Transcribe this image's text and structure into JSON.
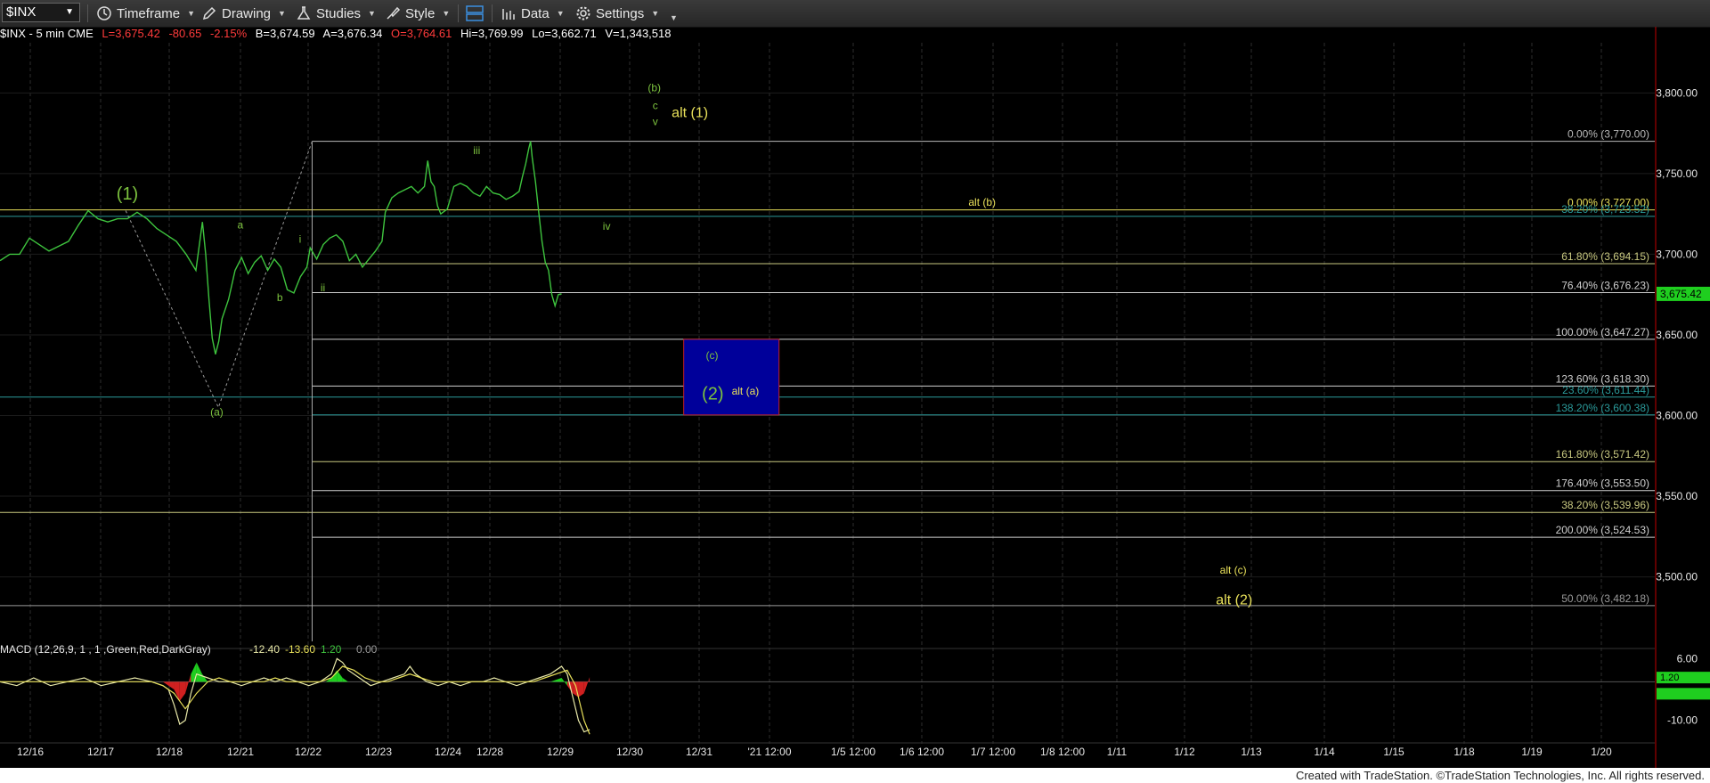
{
  "toolbar": {
    "symbol": "$INX",
    "items": [
      {
        "label": "Timeframe",
        "icon": "clock-icon"
      },
      {
        "label": "Drawing",
        "icon": "pencil-icon"
      },
      {
        "label": "Studies",
        "icon": "flask-icon"
      },
      {
        "label": "Style",
        "icon": "style-icon"
      },
      {
        "label": "Data",
        "icon": "data-icon"
      },
      {
        "label": "Settings",
        "icon": "gear-icon"
      }
    ],
    "layout_icon": "layout-icon"
  },
  "info_bar": {
    "symbol": "$INX - 5 min  CME",
    "last": "L=3,675.42",
    "change": "-80.65",
    "change_pct": "-2.15%",
    "bid": "B=3,674.59",
    "ask": "A=3,676.34",
    "open": "O=3,764.61",
    "high": "Hi=3,769.99",
    "low": "Lo=3,662.71",
    "volume": "V=1,343,518"
  },
  "colors": {
    "price": "#3ec43e",
    "wave_green": "#7cc23e",
    "alt_yellow": "#e8e05a",
    "fib_white": "#cfcfcf",
    "fib_teal": "#2a9a9a",
    "target_box": "#00009a",
    "target_border": "#c0202a",
    "negative": "#ff3b3b",
    "current_price_bg": "#1fce1f"
  },
  "chart_data": [
    {
      "type": "line",
      "title": "$INX - 5 min",
      "x_ticks": [
        "12/16",
        "12/17",
        "12/18",
        "12/21",
        "12/22",
        "12/23",
        "12/24",
        "12/28",
        "12/29",
        "12/30",
        "12/31",
        "'21 12:00",
        "1/5 12:00",
        "1/6 12:00",
        "1/7 12:00",
        "1/8 12:00",
        "1/11",
        "1/12",
        "1/13",
        "1/14",
        "1/15",
        "1/18",
        "1/19",
        "1/20"
      ],
      "y_ticks": [
        "3,800.00",
        "3,750.00",
        "3,700.00",
        "3,650.00",
        "3,600.00",
        "3,550.00",
        "3,500.00"
      ],
      "ylim": [
        3460,
        3830
      ],
      "current_price": "3,675.42",
      "series": [
        {
          "points": [
            [
              0,
              3696
            ],
            [
              3,
              3700
            ],
            [
              6,
              3700
            ],
            [
              9,
              3710
            ],
            [
              12,
              3706
            ],
            [
              15,
              3702
            ],
            [
              18,
              3705
            ],
            [
              21,
              3708
            ],
            [
              24,
              3718
            ],
            [
              27,
              3727
            ],
            [
              30,
              3722
            ],
            [
              33,
              3720
            ],
            [
              36,
              3722
            ],
            [
              39,
              3722
            ],
            [
              42,
              3726
            ],
            [
              45,
              3722
            ],
            [
              48,
              3716
            ],
            [
              51,
              3712
            ],
            [
              54,
              3708
            ],
            [
              57,
              3700
            ],
            [
              60,
              3690
            ],
            [
              61,
              3705
            ],
            [
              62,
              3720
            ],
            [
              63,
              3700
            ],
            [
              64,
              3672
            ],
            [
              65,
              3648
            ],
            [
              66,
              3638
            ],
            [
              67,
              3646
            ],
            [
              68,
              3660
            ],
            [
              70,
              3672
            ],
            [
              72,
              3690
            ],
            [
              74,
              3698
            ],
            [
              76,
              3688
            ],
            [
              78,
              3695
            ],
            [
              80,
              3699
            ],
            [
              82,
              3690
            ],
            [
              84,
              3697
            ],
            [
              86,
              3692
            ],
            [
              88,
              3678
            ],
            [
              90,
              3676
            ],
            [
              92,
              3686
            ],
            [
              94,
              3692
            ],
            [
              95,
              3704
            ],
            [
              97,
              3697
            ],
            [
              99,
              3706
            ],
            [
              101,
              3710
            ],
            [
              103,
              3712
            ],
            [
              105,
              3708
            ],
            [
              107,
              3696
            ],
            [
              109,
              3700
            ],
            [
              111,
              3692
            ],
            [
              113,
              3697
            ],
            [
              115,
              3702
            ],
            [
              117,
              3708
            ],
            [
              118,
              3726
            ],
            [
              120,
              3735
            ],
            [
              122,
              3738
            ],
            [
              124,
              3740
            ],
            [
              126,
              3742
            ],
            [
              128,
              3738
            ],
            [
              130,
              3742
            ],
            [
              131,
              3758
            ],
            [
              132,
              3745
            ],
            [
              133,
              3742
            ],
            [
              134,
              3730
            ],
            [
              135,
              3725
            ],
            [
              137,
              3728
            ],
            [
              139,
              3742
            ],
            [
              141,
              3744
            ],
            [
              143,
              3742
            ],
            [
              145,
              3738
            ],
            [
              147,
              3736
            ],
            [
              149,
              3742
            ],
            [
              151,
              3738
            ],
            [
              153,
              3737
            ],
            [
              155,
              3734
            ],
            [
              157,
              3736
            ],
            [
              159,
              3739
            ],
            [
              160,
              3748
            ],
            [
              161,
              3756
            ],
            [
              162,
              3766
            ],
            [
              162.5,
              3770
            ],
            [
              163,
              3760
            ],
            [
              164,
              3745
            ],
            [
              165,
              3726
            ],
            [
              166,
              3708
            ],
            [
              167,
              3695
            ],
            [
              168,
              3690
            ],
            [
              169,
              3675
            ],
            [
              170,
              3668
            ],
            [
              171,
              3675
            ],
            [
              172,
              3675.4
            ]
          ]
        }
      ],
      "fib_levels": [
        {
          "label": "0.00% (3,770.00)",
          "value": 3770,
          "color": "#b8b8b8",
          "start": 95.6
        },
        {
          "label": "0.00% (3,727.00)",
          "value": 3727.5,
          "color": "#e8e05a",
          "start": 0
        },
        {
          "label": "38.20% (3,723.52)",
          "value": 3723.5,
          "color": "#2a9a9a",
          "start": 0
        },
        {
          "label": "61.80% (3,694.15)",
          "value": 3694.15,
          "color": "#c8c880",
          "start": 95.6
        },
        {
          "label": "76.40% (3,676.23)",
          "value": 3676.23,
          "color": "#cfcfcf",
          "start": 95.6
        },
        {
          "label": "100.00% (3,647.27)",
          "value": 3647.27,
          "color": "#cfcfcf",
          "start": 95.6
        },
        {
          "label": "123.60% (3,618.30)",
          "value": 3618.3,
          "color": "#cfcfcf",
          "start": 95.6
        },
        {
          "label": "23.60% (3,611.44)",
          "value": 3611.44,
          "color": "#2a9a9a",
          "start": 0
        },
        {
          "label": "138.20% (3,600.38)",
          "value": 3600.38,
          "color": "#2a9a9a",
          "start": 95.6
        },
        {
          "label": "161.80% (3,571.42)",
          "value": 3571.42,
          "color": "#c8c880",
          "start": 95.6
        },
        {
          "label": "176.40% (3,553.50)",
          "value": 3553.5,
          "color": "#cfcfcf",
          "start": 95.6
        },
        {
          "label": "38.20% (3,539.96)",
          "value": 3539.96,
          "color": "#c8c880",
          "start": 0
        },
        {
          "label": "200.00% (3,524.53)",
          "value": 3524.53,
          "color": "#cfcfcf",
          "start": 95.6
        },
        {
          "label": "50.00% (3,482.18)",
          "value": 3482.18,
          "color": "#9a9a9a",
          "start": 0
        }
      ],
      "target_box": {
        "x_start": 209.4,
        "x_end": 238.6,
        "y_top": 3647.27,
        "y_bottom": 3600.38
      },
      "annotations": [
        {
          "text": "(1)",
          "x": 39.0,
          "y": 3734,
          "color": "#7cc23e",
          "size": "large"
        },
        {
          "text": "a",
          "x": 73.6,
          "y": 3716,
          "color": "#7cc23e",
          "size": "small"
        },
        {
          "text": "b",
          "x": 85.7,
          "y": 3671,
          "color": "#7cc23e",
          "size": "small"
        },
        {
          "text": "(a)",
          "x": 66.4,
          "y": 3600,
          "color": "#7cc23e",
          "size": "small"
        },
        {
          "text": "i",
          "x": 91.9,
          "y": 3707,
          "color": "#7cc23e",
          "size": "small"
        },
        {
          "text": "ii",
          "x": 98.9,
          "y": 3677,
          "color": "#7cc23e",
          "size": "small"
        },
        {
          "text": "iii",
          "x": 146.0,
          "y": 3762,
          "color": "#7cc23e",
          "size": "small"
        },
        {
          "text": "iv",
          "x": 185.8,
          "y": 3715,
          "color": "#7cc23e",
          "size": "small"
        },
        {
          "text": "(b)",
          "x": 200.4,
          "y": 3801,
          "color": "#7cc23e",
          "size": "small"
        },
        {
          "text": "c",
          "x": 200.7,
          "y": 3790,
          "color": "#7cc23e",
          "size": "small"
        },
        {
          "text": "v",
          "x": 200.7,
          "y": 3780,
          "color": "#7cc23e",
          "size": "small"
        },
        {
          "text": "alt (1)",
          "x": 211.3,
          "y": 3785,
          "color": "#e8e05a",
          "size": "medium"
        },
        {
          "text": "alt (b)",
          "x": 300.8,
          "y": 3730,
          "color": "#e8e05a",
          "size": "small"
        },
        {
          "text": "(c)",
          "x": 218.1,
          "y": 3635,
          "color": "#7cc23e",
          "size": "small"
        },
        {
          "text": "(2)",
          "x": 218.3,
          "y": 3610,
          "color": "#7cc23e",
          "size": "large"
        },
        {
          "text": "alt (a)",
          "x": 228.3,
          "y": 3613,
          "color": "#e8e05a",
          "size": "small"
        },
        {
          "text": "alt (c)",
          "x": 377.7,
          "y": 3502,
          "color": "#e8e05a",
          "size": "small"
        },
        {
          "text": "alt (2)",
          "x": 378.0,
          "y": 3483,
          "color": "#e8e05a",
          "size": "medium"
        }
      ],
      "dotted_lines": [
        [
          [
            38.5,
            3727
          ],
          [
            66.9,
            3605
          ],
          [
            95.6,
            3770
          ]
        ]
      ],
      "vertical_line": {
        "x": 95.6,
        "y_from": 3770,
        "y_to": 3460
      }
    },
    {
      "type": "line",
      "title": "MACD (12,26,9, 1 , 1 ,Green,Red,DarkGray)",
      "legend_values": [
        "-12.40",
        "-13.60",
        "1.20",
        "0.00"
      ],
      "legend_colors": [
        "#e8e8a8",
        "#e8e05a",
        "#3ec43e",
        "#9a9a9a"
      ],
      "y_ticks": [
        "6.00",
        "-10.00"
      ],
      "current_value": "1.20",
      "ylim": [
        -14,
        7
      ],
      "x_max": 210,
      "macd": [
        [
          0,
          0
        ],
        [
          6,
          -1
        ],
        [
          12,
          1
        ],
        [
          18,
          -1
        ],
        [
          24,
          0
        ],
        [
          30,
          1
        ],
        [
          36,
          -1
        ],
        [
          42,
          0
        ],
        [
          48,
          1
        ],
        [
          54,
          0
        ],
        [
          58,
          -1
        ],
        [
          60,
          -2
        ],
        [
          62,
          -6
        ],
        [
          64,
          -11
        ],
        [
          66,
          -10
        ],
        [
          68,
          -3
        ],
        [
          70,
          2
        ],
        [
          74,
          1
        ],
        [
          78,
          0
        ],
        [
          82,
          0
        ],
        [
          86,
          -1
        ],
        [
          90,
          0
        ],
        [
          94,
          1
        ],
        [
          98,
          0
        ],
        [
          102,
          1
        ],
        [
          106,
          0
        ],
        [
          110,
          -1
        ],
        [
          114,
          0
        ],
        [
          118,
          2
        ],
        [
          120,
          6
        ],
        [
          122,
          5
        ],
        [
          124,
          3
        ],
        [
          128,
          1
        ],
        [
          132,
          -1
        ],
        [
          136,
          0
        ],
        [
          140,
          1
        ],
        [
          144,
          2
        ],
        [
          146,
          4
        ],
        [
          148,
          2
        ],
        [
          152,
          0
        ],
        [
          156,
          -1
        ],
        [
          160,
          0
        ],
        [
          164,
          -1
        ],
        [
          168,
          0
        ],
        [
          172,
          0
        ],
        [
          176,
          1
        ],
        [
          180,
          0
        ],
        [
          184,
          -1
        ],
        [
          188,
          0
        ],
        [
          192,
          1
        ],
        [
          196,
          2
        ],
        [
          200,
          4
        ],
        [
          202,
          2
        ],
        [
          204,
          -4
        ],
        [
          206,
          -10
        ],
        [
          208,
          -13
        ],
        [
          210,
          -12.4
        ]
      ],
      "signal": [
        [
          0,
          0
        ],
        [
          6,
          0
        ],
        [
          12,
          0
        ],
        [
          18,
          0
        ],
        [
          24,
          0
        ],
        [
          30,
          0
        ],
        [
          36,
          0
        ],
        [
          42,
          0
        ],
        [
          48,
          0
        ],
        [
          54,
          0
        ],
        [
          58,
          -1
        ],
        [
          62,
          -3
        ],
        [
          66,
          -7
        ],
        [
          70,
          -3
        ],
        [
          74,
          0
        ],
        [
          78,
          1
        ],
        [
          82,
          0
        ],
        [
          86,
          0
        ],
        [
          90,
          0
        ],
        [
          94,
          0
        ],
        [
          98,
          1
        ],
        [
          102,
          0
        ],
        [
          106,
          0
        ],
        [
          110,
          0
        ],
        [
          114,
          0
        ],
        [
          118,
          1
        ],
        [
          122,
          4
        ],
        [
          126,
          3
        ],
        [
          130,
          1
        ],
        [
          134,
          0
        ],
        [
          138,
          0
        ],
        [
          142,
          1
        ],
        [
          146,
          2
        ],
        [
          150,
          1
        ],
        [
          154,
          0
        ],
        [
          158,
          0
        ],
        [
          162,
          0
        ],
        [
          166,
          0
        ],
        [
          170,
          0
        ],
        [
          174,
          0
        ],
        [
          178,
          0
        ],
        [
          182,
          0
        ],
        [
          186,
          0
        ],
        [
          190,
          0
        ],
        [
          194,
          1
        ],
        [
          198,
          2
        ],
        [
          202,
          3
        ],
        [
          205,
          -1
        ],
        [
          208,
          -10
        ],
        [
          210,
          -13.6
        ]
      ],
      "histogram": [
        [
          58,
          0
        ],
        [
          62,
          -2
        ],
        [
          64,
          -5
        ],
        [
          66,
          -3
        ],
        [
          68,
          2
        ],
        [
          70,
          5
        ],
        [
          72,
          2
        ],
        [
          74,
          0
        ],
        [
          116,
          0
        ],
        [
          118,
          1
        ],
        [
          120,
          3
        ],
        [
          122,
          1
        ],
        [
          124,
          0
        ],
        [
          196,
          0
        ],
        [
          200,
          1
        ],
        [
          202,
          -1
        ],
        [
          204,
          -3
        ],
        [
          206,
          -4
        ],
        [
          208,
          -3
        ],
        [
          210,
          1.2
        ]
      ]
    }
  ],
  "footer": {
    "text": "Created with TradeStation. ©TradeStation Technologies, Inc. All rights reserved."
  }
}
